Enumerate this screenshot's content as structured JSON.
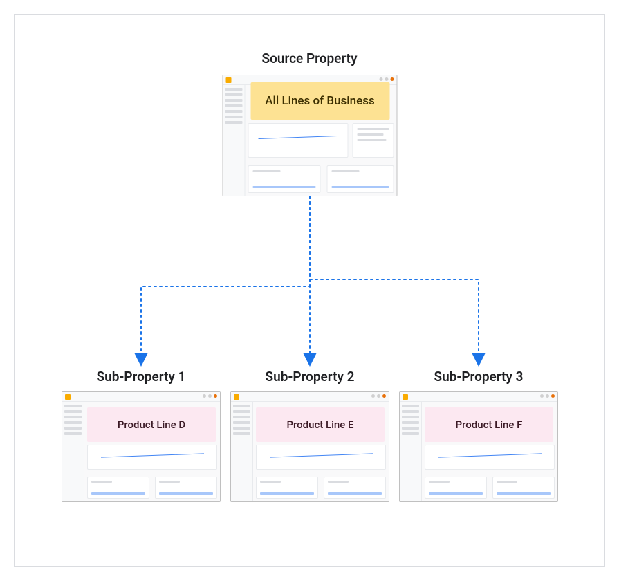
{
  "source": {
    "title": "Source Property",
    "overlay_label": "All Lines of Business"
  },
  "subs": [
    {
      "title": "Sub-Property 1",
      "overlay_label": "Product Line D"
    },
    {
      "title": "Sub-Property 2",
      "overlay_label": "Product Line E"
    },
    {
      "title": "Sub-Property 3",
      "overlay_label": "Product Line F"
    }
  ]
}
